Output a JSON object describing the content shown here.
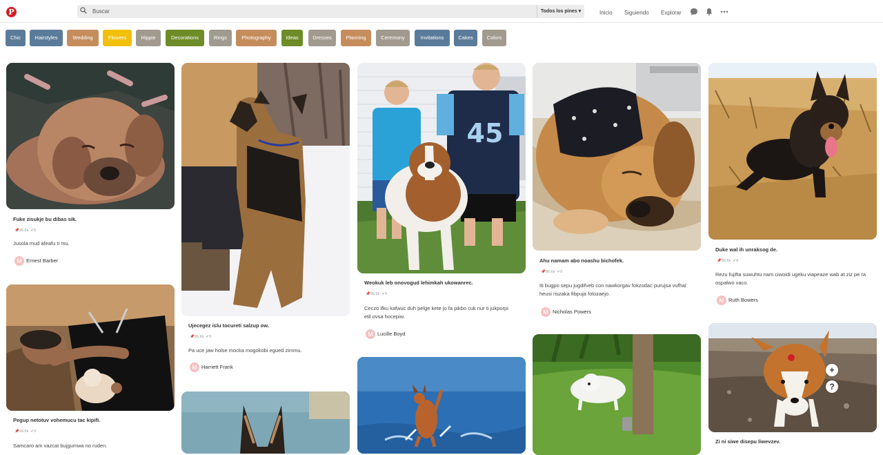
{
  "header": {
    "logo": "P",
    "search_placeholder": "Buscar",
    "search_scope": "Todos los pines ▾",
    "nav": [
      "Inicio",
      "Siguiendo",
      "Explorar"
    ]
  },
  "tags": [
    {
      "label": "Chic",
      "color": "#5b7b9a"
    },
    {
      "label": "Hairstyles",
      "color": "#5b7b9a"
    },
    {
      "label": "Wedding",
      "color": "#c58d5c"
    },
    {
      "label": "Flowers",
      "color": "#f2bf0c"
    },
    {
      "label": "Hippie",
      "color": "#a19a8f"
    },
    {
      "label": "Decorations",
      "color": "#6e8c27"
    },
    {
      "label": "Rings",
      "color": "#a19a8f"
    },
    {
      "label": "Photography",
      "color": "#c58d5c"
    },
    {
      "label": "Ideas",
      "color": "#6e8c27"
    },
    {
      "label": "Dresses",
      "color": "#a19a8f"
    },
    {
      "label": "Planning",
      "color": "#c58d5c"
    },
    {
      "label": "Ceremony",
      "color": "#a19a8f"
    },
    {
      "label": "Invitations",
      "color": "#5b7b9a"
    },
    {
      "label": "Cakes",
      "color": "#5b7b9a"
    },
    {
      "label": "Colors",
      "color": "#a19a8f"
    }
  ],
  "pins": [
    {
      "title": "Fuke zisukje bu dibas sik.",
      "saves": "36.6k",
      "likes": "9",
      "desc": "Jusola mud afeafu ti mu.",
      "user": "Ernest Barber"
    },
    {
      "title": "Pegup netotuv vohemucu tac kipifi.",
      "saves": "36.6k",
      "likes": "9",
      "desc": "Samcaro am vazcat bujgumwa no ruden.",
      "user": ""
    },
    {
      "title": "Ujecegez islu tocureti salzup ow.",
      "saves": "36.6k",
      "likes": "9",
      "desc": "Pa uce jaw holse mocka mogokobi egued zimmu.",
      "user": "Harriett Frank"
    },
    {
      "title": "Weokuk leb onovogud lehimkah ukowanrec.",
      "saves": "36.6k",
      "likes": "9",
      "desc": "Ceczo ifku kafwuc duh pelge kete jo fa pikbo cuk nur ti jukporpi etil ovsa hocepiw.",
      "user": "Lucille Boyd"
    },
    {
      "title": "Ahu namam abo noashu bichofek.",
      "saves": "36.6k",
      "likes": "9",
      "desc": "Iti bugpo sepu jugdifveb con nawkorgav fokzodac purujsa vufhal heusi riszaka fibpuja folozaejo.",
      "user": "Nicholas Powers"
    },
    {
      "title": "Duke wal ih unraksog de.",
      "saves": "36.6k",
      "likes": "9",
      "desc": "Rezu fujifta suwuhtu nam ciwoidi ugeku viapeaze wab at ziz pe ra ospalwo vaco.",
      "user": "Ruth Bowers"
    },
    {
      "title": "Zi ni siwe disepu liwevzev.",
      "saves": "",
      "likes": "",
      "desc": "",
      "user": ""
    }
  ],
  "avatar_letter": "M",
  "pin_image_labels": {
    "jersey_number": "45"
  },
  "float_buttons": {
    "plus": "+",
    "help": "?"
  }
}
